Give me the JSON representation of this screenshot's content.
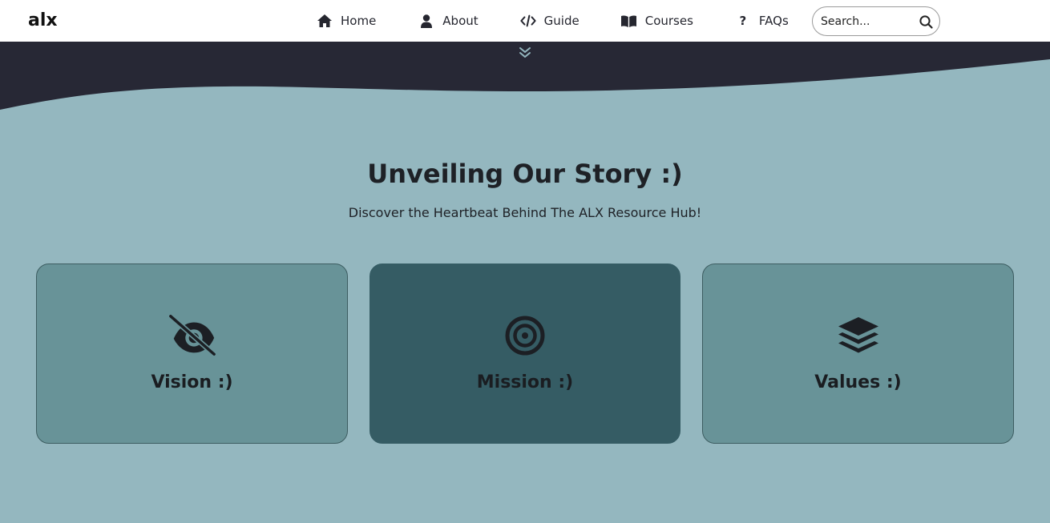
{
  "brand": {
    "logo_text": "alx"
  },
  "nav": {
    "items": [
      {
        "label": "Home",
        "icon": "home-icon"
      },
      {
        "label": "About",
        "icon": "user-icon"
      },
      {
        "label": "Guide",
        "icon": "code-icon"
      },
      {
        "label": "Courses",
        "icon": "book-icon"
      },
      {
        "label": "FAQs",
        "icon": "question-icon"
      }
    ]
  },
  "search": {
    "placeholder": "Search...",
    "value": ""
  },
  "hero": {
    "scroll_icon": "double-chevron-down-icon"
  },
  "about": {
    "title": "Unveiling Our Story :)",
    "subtitle": "Discover the Heartbeat Behind The ALX Resource Hub!",
    "cards": [
      {
        "label": "Vision :)",
        "icon": "eye-slash-icon"
      },
      {
        "label": "Mission :)",
        "icon": "bullseye-icon",
        "active": true
      },
      {
        "label": "Values :)",
        "icon": "layers-icon"
      }
    ]
  },
  "colors": {
    "page_bg": "#94b7bf",
    "dark_band": "#272835",
    "card_bg": "#689398",
    "card_active_bg": "#355c64",
    "navbar_bg": "#ffffff"
  }
}
